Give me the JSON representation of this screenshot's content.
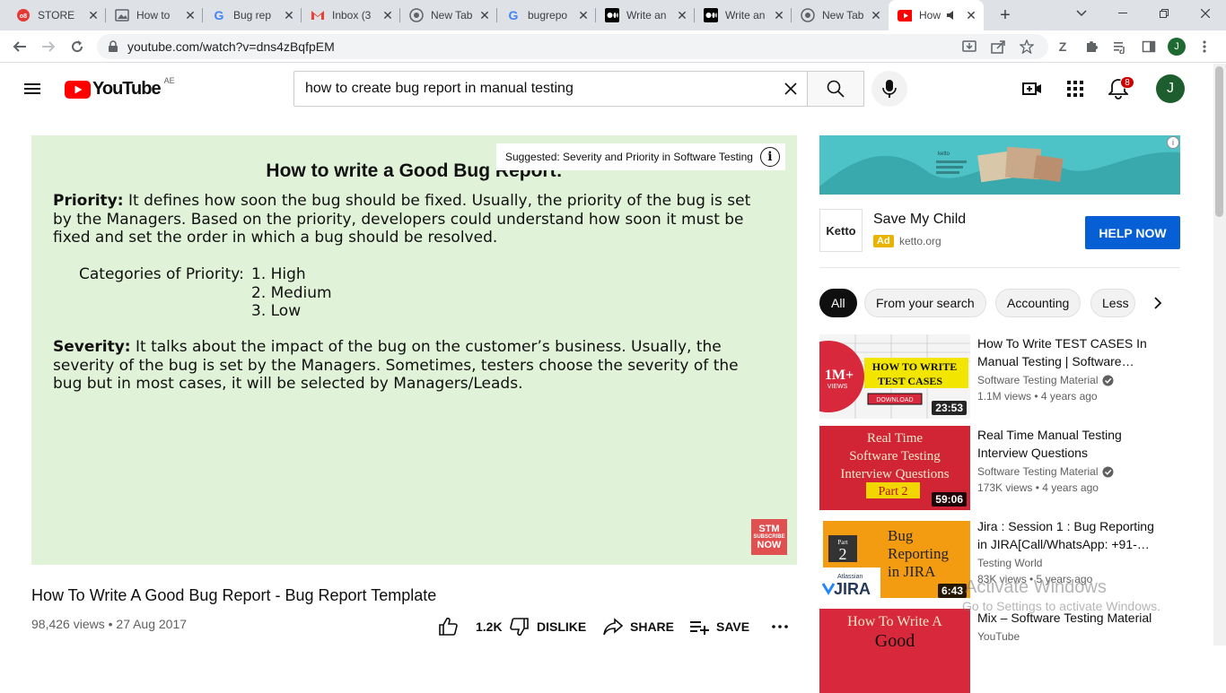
{
  "browser": {
    "tabs": [
      {
        "title": "STORE",
        "icon": "red-store-icon"
      },
      {
        "title": "How to",
        "icon": "image-icon"
      },
      {
        "title": "Bug rep",
        "icon": "google-icon"
      },
      {
        "title": "Inbox (3",
        "icon": "gmail-icon"
      },
      {
        "title": "New Tab",
        "icon": "chrome-icon"
      },
      {
        "title": "bugrepo",
        "icon": "google-icon"
      },
      {
        "title": "Write an",
        "icon": "medium-icon"
      },
      {
        "title": "Write an",
        "icon": "medium-icon"
      },
      {
        "title": "New Tab",
        "icon": "chrome-icon"
      },
      {
        "title": "How",
        "icon": "youtube-icon",
        "active": true
      }
    ],
    "url": "youtube.com/watch?v=dns4zBqfpEM",
    "profile_initial": "J",
    "extension_letter": "Z"
  },
  "youtube": {
    "country_code": "AE",
    "logo_text": "YouTube",
    "search_value": "how to create bug report in manual testing",
    "notification_count": "8",
    "avatar_initial": "J"
  },
  "player": {
    "suggested": "Suggested: Severity and Priority in Software Testing",
    "slide": {
      "title": "How to write a Good Bug Report:",
      "priority_label": "Priority:",
      "priority_text": " It defines how soon the bug should be fixed. Usually, the priority of the bug is set by the Managers. Based on the priority, developers could understand how soon it must be fixed and set the order in which a bug should be resolved.",
      "categories_label": "Categories of Priority:",
      "categories": [
        "1. High",
        "2. Medium",
        "3. Low"
      ],
      "severity_label": "Severity:",
      "severity_text": " It talks about the impact of the bug on the customer’s business. Usually, the severity of the bug is set by the Managers. Sometimes, testers choose the severity of the bug but in most cases, it will be selected by Managers/Leads."
    },
    "stm_badge": {
      "top": "STM",
      "mid": "SUBSCRIBE",
      "bottom": "NOW"
    }
  },
  "video": {
    "title": "How To Write A Good Bug Report - Bug Report Template",
    "views": "98,426 views",
    "date": "27 Aug 2017",
    "like_count": "1.2K",
    "dislike_label": "DISLIKE",
    "share_label": "SHARE",
    "save_label": "SAVE"
  },
  "ad": {
    "title": "Save My Child",
    "tag": "Ad",
    "domain": "ketto.org",
    "logo_text": "Ketto",
    "cta": "HELP NOW",
    "banner_brand": "ketto"
  },
  "chips": [
    "All",
    "From your search",
    "Accounting",
    "Less"
  ],
  "recommendations": [
    {
      "title": "How To Write TEST CASES In Manual Testing | Software…",
      "channel": "Software Testing Material",
      "verified": true,
      "stats": "1.1M views • 4 years ago",
      "duration": "23:53",
      "thumb_text": [
        "1M+",
        "VIEWS",
        "HOW TO WRITE",
        "TEST CASES",
        "DOWNLOAD"
      ]
    },
    {
      "title": "Real Time Manual Testing Interview Questions",
      "channel": "Software Testing Material",
      "verified": true,
      "stats": "173K views • 4 years ago",
      "duration": "59:06",
      "thumb_text": [
        "Real Time",
        "Software Testing",
        "Interview Questions",
        "Part 2"
      ]
    },
    {
      "title": "Jira : Session 1 : Bug Reporting in JIRA[Call/WhatsApp: +91-…",
      "channel": "Testing World",
      "verified": false,
      "stats": "83K views • 5 years ago",
      "duration": "6:43",
      "thumb_text": [
        "Part",
        "2",
        "Bug",
        "Reporting",
        "in JIRA",
        "Atlassian",
        "JIRA"
      ]
    },
    {
      "title": "Mix – Software Testing Material",
      "channel": "YouTube",
      "verified": false,
      "stats": "",
      "duration": "",
      "thumb_text": [
        "How To Write A",
        "Good"
      ]
    }
  ],
  "watermark": {
    "line1": "Activate Windows",
    "line2": "Go to Settings to activate Windows."
  },
  "colors": {
    "youtube_red": "#ff0000",
    "cta_blue": "#065fd4",
    "slide_bg": "#e0f2d8",
    "ad_banner": "#4ec3c7"
  }
}
